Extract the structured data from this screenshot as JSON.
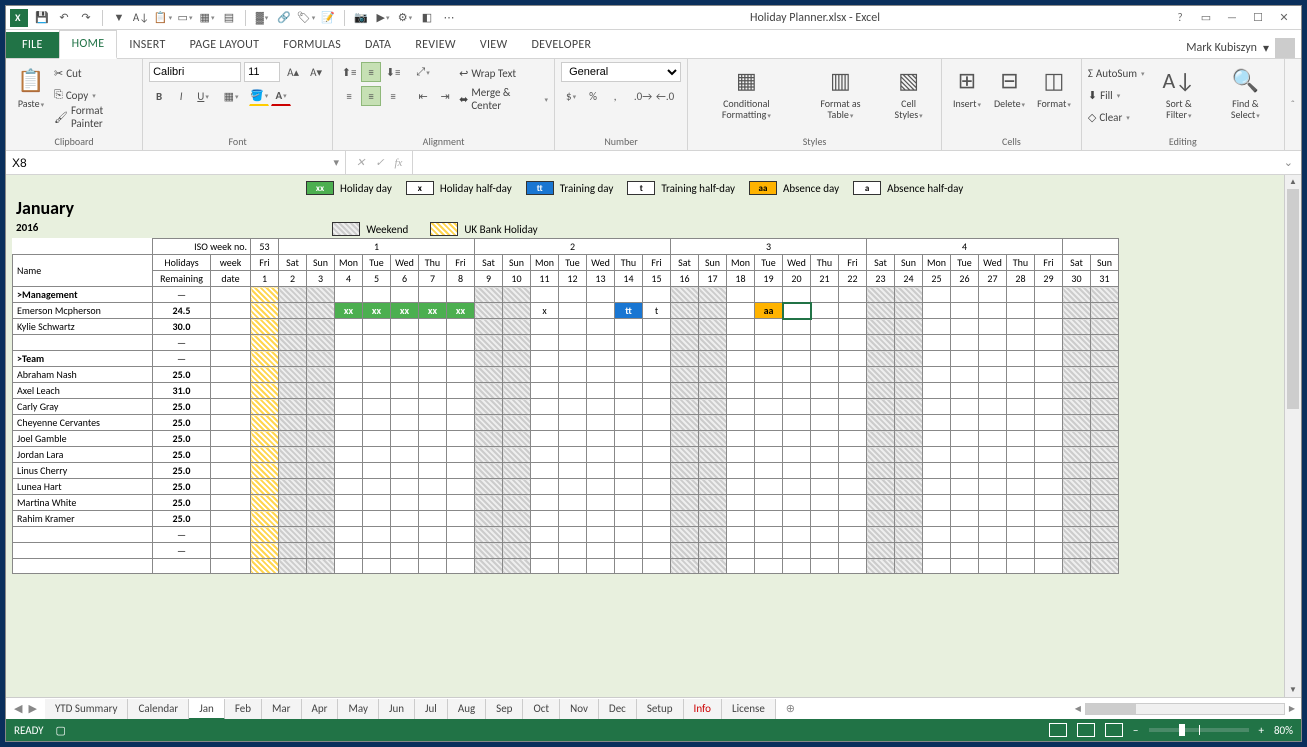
{
  "app": {
    "title": "Holiday Planner.xlsx - Excel",
    "user": "Mark Kubiszyn"
  },
  "ribbon_tabs": [
    "FILE",
    "HOME",
    "INSERT",
    "PAGE LAYOUT",
    "FORMULAS",
    "DATA",
    "REVIEW",
    "VIEW",
    "DEVELOPER"
  ],
  "ribbon_active": "HOME",
  "clipboard": {
    "paste": "Paste",
    "cut": "Cut",
    "copy": "Copy",
    "painter": "Format Painter",
    "label": "Clipboard"
  },
  "font": {
    "name": "Calibri",
    "size": "11",
    "label": "Font"
  },
  "alignment": {
    "wrap": "Wrap Text",
    "merge": "Merge & Center",
    "label": "Alignment"
  },
  "number": {
    "format": "General",
    "label": "Number"
  },
  "styles": {
    "cond": "Conditional Formatting",
    "table": "Format as Table",
    "cell": "Cell Styles",
    "label": "Styles"
  },
  "cells": {
    "insert": "Insert",
    "delete": "Delete",
    "format": "Format",
    "label": "Cells"
  },
  "editing": {
    "autosum": "AutoSum",
    "fill": "Fill",
    "clear": "Clear",
    "sort": "Sort & Filter",
    "find": "Find & Select",
    "label": "Editing"
  },
  "namebox": "X8",
  "formula": "",
  "legend": {
    "holiday": "Holiday day",
    "holidayhalf": "Holiday half-day",
    "training": "Training day",
    "traininghalf": "Training half-day",
    "absence": "Absence day",
    "absencehalf": "Absence half-day",
    "weekend": "Weekend",
    "bank": "UK Bank Holiday",
    "code_holiday": "xx",
    "code_holidayhalf": "x",
    "code_training": "tt",
    "code_traininghalf": "t",
    "code_absence": "aa",
    "code_absencehalf": "a"
  },
  "planner": {
    "month": "January",
    "year": "2016",
    "iso_label": "ISO week no.",
    "iso_weeks": [
      "53",
      "1",
      "",
      "2",
      "",
      "3",
      "",
      "4",
      ""
    ],
    "header_name": "Name",
    "header_hol1": "Holidays",
    "header_hol2": "Remaining",
    "header_wk1": "week",
    "header_wk2": "date",
    "days_of_week": [
      "Fri",
      "Sat",
      "Sun",
      "Mon",
      "Tue",
      "Wed",
      "Thu",
      "Fri",
      "Sat",
      "Sun",
      "Mon",
      "Tue",
      "Wed",
      "Thu",
      "Fri",
      "Sat",
      "Sun",
      "Mon",
      "Tue",
      "Wed",
      "Thu",
      "Fri",
      "Sat",
      "Sun",
      "Mon",
      "Tue",
      "Wed",
      "Thu",
      "Fri",
      "Sat",
      "Sun"
    ],
    "dates": [
      "1",
      "2",
      "3",
      "4",
      "5",
      "6",
      "7",
      "8",
      "9",
      "10",
      "11",
      "12",
      "13",
      "14",
      "15",
      "16",
      "17",
      "18",
      "19",
      "20",
      "21",
      "22",
      "23",
      "24",
      "25",
      "26",
      "27",
      "28",
      "29",
      "30",
      "31"
    ],
    "weekend_idx": [
      1,
      2,
      8,
      9,
      15,
      16,
      22,
      23,
      29,
      30
    ],
    "bank_idx": [
      0
    ],
    "groups": [
      {
        "label": ">Management",
        "rows": [
          {
            "name": "Emerson Mcpherson",
            "hol": "24.5",
            "cells": {
              "3": "xx",
              "4": "xx",
              "5": "xx",
              "6": "xx",
              "7": "xx",
              "10": "x",
              "13": "tt",
              "14": "t",
              "18": "aa"
            }
          },
          {
            "name": "Kylie Schwartz",
            "hol": "30.0",
            "cells": {}
          }
        ]
      },
      {
        "label": ">Team",
        "rows": [
          {
            "name": "Abraham Nash",
            "hol": "25.0",
            "cells": {}
          },
          {
            "name": "Axel Leach",
            "hol": "31.0",
            "cells": {}
          },
          {
            "name": "Carly Gray",
            "hol": "25.0",
            "cells": {}
          },
          {
            "name": "Cheyenne Cervantes",
            "hol": "25.0",
            "cells": {}
          },
          {
            "name": "Joel Gamble",
            "hol": "25.0",
            "cells": {}
          },
          {
            "name": "Jordan Lara",
            "hol": "25.0",
            "cells": {}
          },
          {
            "name": "Linus Cherry",
            "hol": "25.0",
            "cells": {}
          },
          {
            "name": "Lunea Hart",
            "hol": "25.0",
            "cells": {}
          },
          {
            "name": "Martina White",
            "hol": "25.0",
            "cells": {}
          },
          {
            "name": "Rahim Kramer",
            "hol": "25.0",
            "cells": {}
          }
        ]
      }
    ],
    "dash": "—",
    "selected_cell": 19
  },
  "sheet_tabs": [
    "YTD Summary",
    "Calendar",
    "Jan",
    "Feb",
    "Mar",
    "Apr",
    "May",
    "Jun",
    "Jul",
    "Aug",
    "Sep",
    "Oct",
    "Nov",
    "Dec",
    "Setup",
    "Info",
    "License"
  ],
  "sheet_active": "Jan",
  "status": {
    "ready": "READY",
    "zoom": "80%"
  }
}
